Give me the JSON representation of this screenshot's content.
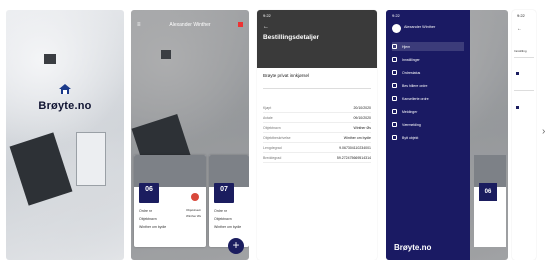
{
  "screen1": {
    "logo_text": "Brøyte.no"
  },
  "screen2": {
    "status_time": "",
    "header_title": "Alexander Winther",
    "cards": [
      {
        "day": "06",
        "month": "",
        "row1": "Ordre nr",
        "row2": "Objektnavn",
        "row3": "Winther om bydie",
        "badge": ""
      },
      {
        "day": "07",
        "month": "",
        "row1": "Ordre nr",
        "row2": "Objektnavn",
        "row3": "Winther om bydie",
        "badge": ""
      }
    ],
    "center_pin_label1": "Objektnavn",
    "center_pin_label2": "Winther Øs",
    "fab_symbol": "+"
  },
  "screen3": {
    "time": "9:22",
    "back_symbol": "←",
    "title": "Bestillingsdetaljer",
    "section_title": "Brøyte privat innkjørsel",
    "section_sub": "",
    "section_button": "",
    "rows": [
      {
        "k": "Kjøpt",
        "v": "20/10/2020"
      },
      {
        "k": "Avtale",
        "v": "09/10/2020"
      },
      {
        "k": "Objektnavn",
        "v": "Winther Øs"
      },
      {
        "k": "Objektbeskrivelse",
        "v": "Winther om bydie"
      },
      {
        "k": "Lengdegrad",
        "v": "9.067304110234001"
      },
      {
        "k": "Breddegrad",
        "v": "59.272475669514314"
      }
    ]
  },
  "screen4": {
    "time": "9:22",
    "user_name": "Alexander Winther",
    "user_phone": "",
    "menu": [
      {
        "label": "Hjem",
        "active": true
      },
      {
        "label": "Innstillinger",
        "active": false
      },
      {
        "label": "Ordrestatus",
        "active": false
      },
      {
        "label": "Bes hillere ordre",
        "active": false
      },
      {
        "label": "Kansellerte ordre",
        "active": false
      },
      {
        "label": "Meldinger",
        "active": false
      },
      {
        "label": "Værmelding",
        "active": false
      },
      {
        "label": "Bytt objekt",
        "active": false
      }
    ],
    "drawer_logo": "Brøyte.no",
    "card_day": "06"
  },
  "screen5": {
    "time": "9:22",
    "subtitle": "Innstilling"
  },
  "nav": {
    "next_symbol": "›"
  },
  "colors": {
    "navy": "#1a1a63",
    "dark_header": "#3a3a3a",
    "snow": "#e0e3e6"
  }
}
